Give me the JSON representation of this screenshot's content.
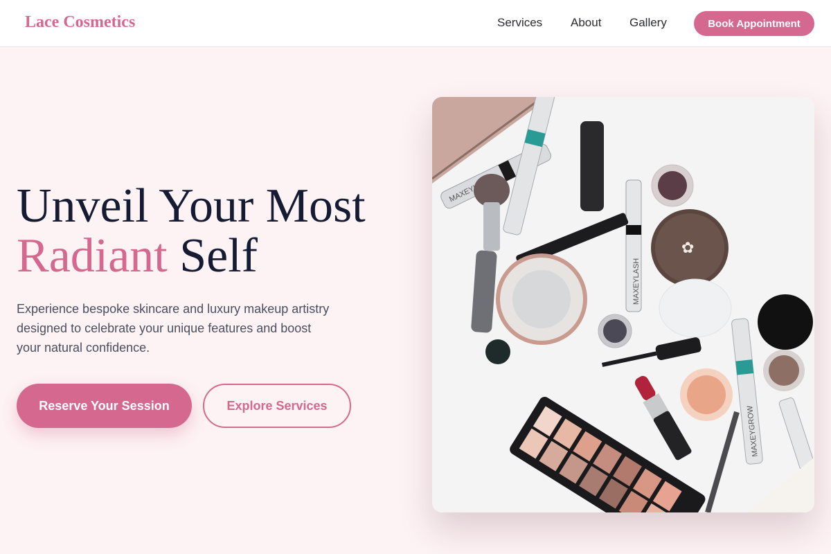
{
  "header": {
    "logo": "Lace Cosmetics",
    "nav": [
      {
        "label": "Services"
      },
      {
        "label": "About"
      },
      {
        "label": "Gallery"
      }
    ],
    "cta_label": "Book Appointment"
  },
  "hero": {
    "title_line1": "Unveil Your Most",
    "title_accent": "Radiant",
    "title_end": " Self",
    "subtitle": "Experience bespoke skincare and luxury makeup artistry designed to celebrate your unique features and boost your natural confidence.",
    "primary_button": "Reserve Your Session",
    "secondary_button": "Explore Services"
  },
  "product_labels": {
    "lash": "MAXEYLASH",
    "grow": "MAXEYGROW"
  },
  "colors": {
    "accent": "#d4688f",
    "heading": "#151b33",
    "background": "#fdf2f4"
  }
}
